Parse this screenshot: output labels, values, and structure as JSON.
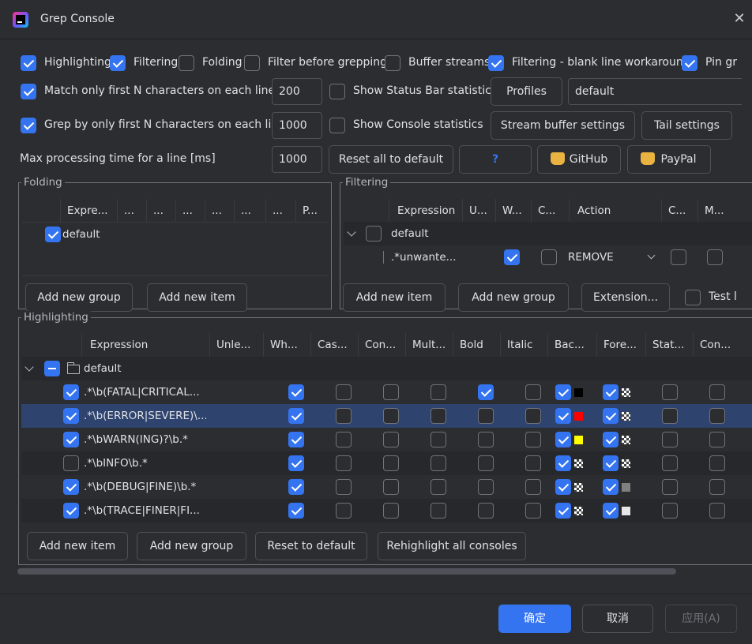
{
  "window": {
    "title": "Grep Console"
  },
  "options_row1": [
    {
      "label": "Highlighting",
      "checked": true
    },
    {
      "label": "Filtering",
      "checked": true
    },
    {
      "label": "Folding",
      "checked": false
    },
    {
      "label": "Filter before grepping",
      "checked": false
    },
    {
      "label": "Buffer streams",
      "checked": false
    },
    {
      "label": "Filtering - blank line workaround",
      "checked": true
    },
    {
      "label": "Pin gr",
      "checked": true
    }
  ],
  "match_first_n": {
    "label": "Match only first N characters on each line",
    "value": "200",
    "checked": true
  },
  "grep_first_n": {
    "label": "Grep by only first N characters on each line",
    "value": "1000",
    "checked": true
  },
  "status_bar_stats": {
    "label": "Show Status Bar statistics",
    "checked": false
  },
  "console_stats": {
    "label": "Show Console statistics",
    "checked": false
  },
  "max_processing": {
    "label": "Max processing time for a line [ms]",
    "value": "1000"
  },
  "buttons": {
    "profiles": "Profiles",
    "profile_name": "default",
    "stream_buffer": "Stream buffer settings",
    "tail": "Tail settings",
    "reset_all": "Reset all to default",
    "help": "?",
    "github": "GitHub",
    "paypal": "PayPal"
  },
  "folding": {
    "title": "Folding",
    "columns": [
      "Expre...",
      "...",
      "...",
      "...",
      "...",
      "...",
      "...",
      "P..."
    ],
    "rows": [
      {
        "name": "default",
        "checked": true
      }
    ],
    "add_group": "Add new group",
    "add_item": "Add new item"
  },
  "filtering": {
    "title": "Filtering",
    "columns": [
      "Expression",
      "U...",
      "W...",
      "C...",
      "Action",
      "C...",
      "M..."
    ],
    "group": "default",
    "rows": [
      {
        "expression": ".*unwante...",
        "whole": true,
        "case": false,
        "action": "REMOVE",
        "c2": false,
        "m": false
      }
    ],
    "add_item": "Add new item",
    "add_group": "Add new group",
    "extension": "Extension...",
    "test": "Test l"
  },
  "highlighting": {
    "title": "Highlighting",
    "columns": [
      "Expression",
      "Unle...",
      "Wh...",
      "Cas...",
      "Con...",
      "Mult...",
      "Bold",
      "Italic",
      "Bac...",
      "Fore...",
      "Stat...",
      "Con..."
    ],
    "group": "default",
    "rows": [
      {
        "enabled": true,
        "expression": ".*\\b(FATAL|CRITICAL...",
        "whole": true,
        "bold": true,
        "bg_on": true,
        "bg": "#000000",
        "fg_on": true,
        "fg": "checker"
      },
      {
        "enabled": true,
        "expression": ".*\\b(ERROR|SEVERE)\\...",
        "whole": true,
        "bold": false,
        "bg_on": true,
        "bg": "#ff0000",
        "fg_on": true,
        "fg": "checker"
      },
      {
        "enabled": true,
        "expression": ".*\\bWARN(ING)?\\b.*",
        "whole": true,
        "bold": false,
        "bg_on": true,
        "bg": "#ffff00",
        "fg_on": true,
        "fg": "checker"
      },
      {
        "enabled": false,
        "expression": ".*\\bINFO\\b.*",
        "whole": true,
        "bold": false,
        "bg_on": true,
        "bg": "checker",
        "fg_on": true,
        "fg": "checker"
      },
      {
        "enabled": true,
        "expression": ".*\\b(DEBUG|FINE)\\b.*",
        "whole": true,
        "bold": false,
        "bg_on": true,
        "bg": "checker",
        "fg_on": true,
        "fg": "#808080"
      },
      {
        "enabled": true,
        "expression": ".*\\b(TRACE|FINER|FI...",
        "whole": true,
        "bold": false,
        "bg_on": true,
        "bg": "checker",
        "fg_on": true,
        "fg": "#e6e6e6"
      }
    ],
    "add_item": "Add new item",
    "add_group": "Add new group",
    "reset": "Reset to default",
    "rehighlight": "Rehighlight all consoles"
  },
  "footer": {
    "ok": "确定",
    "cancel": "取消",
    "apply": "应用(A)"
  },
  "colors": {
    "accent": "#3574f0",
    "background": "#2b2d30",
    "selection": "#2e436e"
  }
}
